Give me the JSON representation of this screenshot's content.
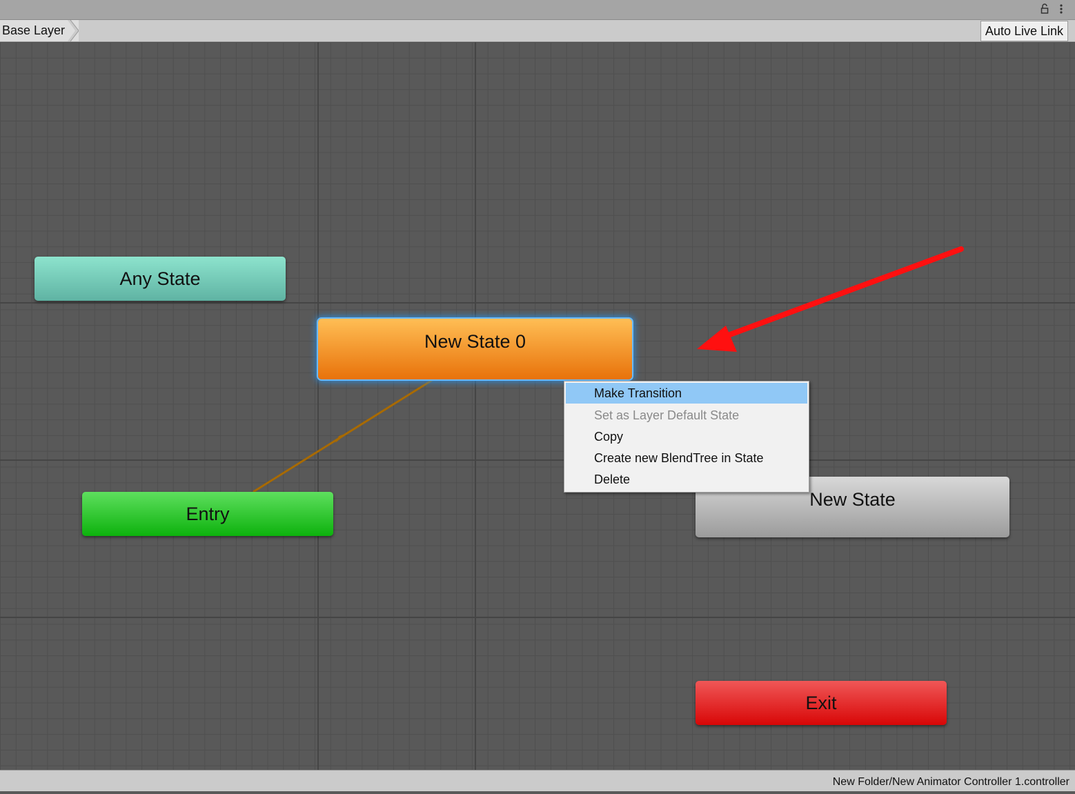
{
  "toolbar": {
    "breadcrumb": "Base Layer",
    "auto_live_link": "Auto Live Link"
  },
  "icons": {
    "lock": "lock-icon",
    "more": "kebab-menu-icon"
  },
  "states": {
    "any_state": "Any State",
    "new_state_0": "New State 0",
    "entry": "Entry",
    "new_state": "New State",
    "exit": "Exit"
  },
  "context_menu": {
    "items": [
      {
        "label": "Make Transition",
        "highlighted": true,
        "enabled": true
      },
      {
        "label": "Set as Layer Default State",
        "highlighted": false,
        "enabled": false
      },
      {
        "label": "Copy",
        "highlighted": false,
        "enabled": true
      },
      {
        "label": "Create new BlendTree in State",
        "highlighted": false,
        "enabled": true
      },
      {
        "label": "Delete",
        "highlighted": false,
        "enabled": true
      }
    ]
  },
  "status": {
    "path": "New Folder/New Animator Controller 1.controller"
  },
  "colors": {
    "any_state": "#5fb3a3",
    "default_state": "#e8720a",
    "entry": "#0db20d",
    "state": "#9b9b9b",
    "exit": "#d80707",
    "selection_glow": "#2b8de0",
    "menu_highlight": "#90c8f6",
    "annotation_arrow": "#ff1010",
    "transition_line": "#a86a00"
  }
}
